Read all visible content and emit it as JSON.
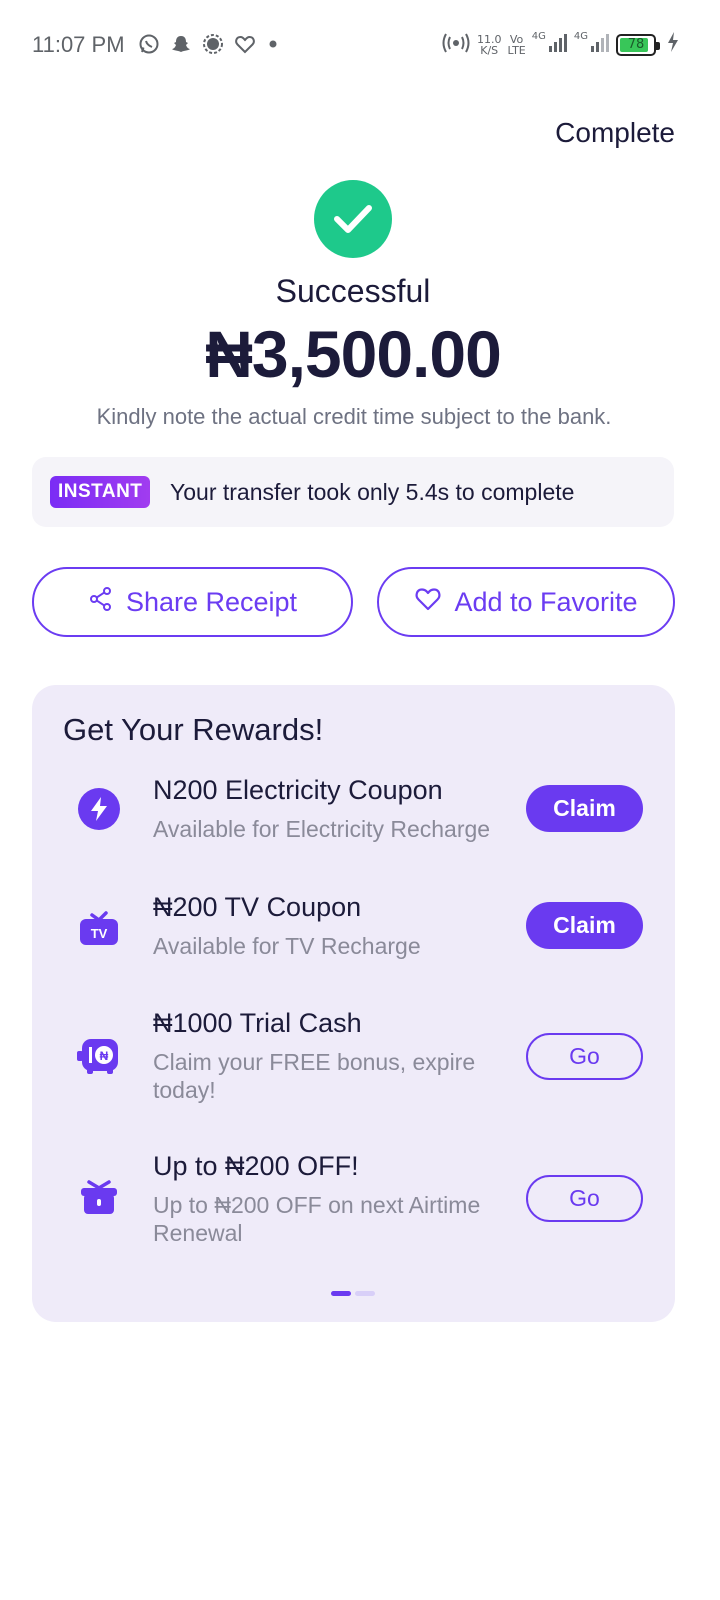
{
  "status_bar": {
    "time": "11:07 PM",
    "net_speed_value": "11.0",
    "net_speed_unit": "K/S",
    "volte_top": "Vo",
    "volte_bottom": "LTE",
    "sim1_label": "4G",
    "sim2_label": "4G",
    "battery_level": "78",
    "icons": [
      "whatsapp-icon",
      "snapchat-icon",
      "signal-app-icon",
      "heart-icon",
      "dot-icon",
      "hotspot-icon",
      "signal-bars-icon",
      "charging-icon"
    ]
  },
  "header": {
    "complete_label": "Complete"
  },
  "result": {
    "status": "Successful",
    "amount": "₦3,500.00",
    "note": "Kindly note the actual credit time subject to the bank.",
    "status_color": "#1ec98b"
  },
  "instant_banner": {
    "badge": "INSTANT",
    "text": "Your transfer took only 5.4s to complete"
  },
  "actions": {
    "share_label": "Share Receipt",
    "favorite_label": "Add to Favorite"
  },
  "rewards": {
    "title": "Get Your Rewards!",
    "items": [
      {
        "icon": "lightning-icon",
        "title": "N200 Electricity Coupon",
        "subtitle": "Available for Electricity Recharge",
        "button": "Claim",
        "button_style": "filled"
      },
      {
        "icon": "tv-icon",
        "title": "₦200 TV Coupon",
        "subtitle": "Available for TV Recharge",
        "button": "Claim",
        "button_style": "filled"
      },
      {
        "icon": "piggy-bank-icon",
        "title": "₦1000 Trial Cash",
        "subtitle": "Claim your FREE bonus, expire today!",
        "button": "Go",
        "button_style": "outline"
      },
      {
        "icon": "gift-icon",
        "title": "Up to ₦200 OFF!",
        "subtitle": "Up to ₦200 OFF on next Airtime Renewal",
        "button": "Go",
        "button_style": "outline"
      }
    ],
    "page_count": 2,
    "active_page": 1
  },
  "colors": {
    "accent": "#6a3af0",
    "success": "#1ec98b",
    "card_bg": "#efebf9"
  }
}
